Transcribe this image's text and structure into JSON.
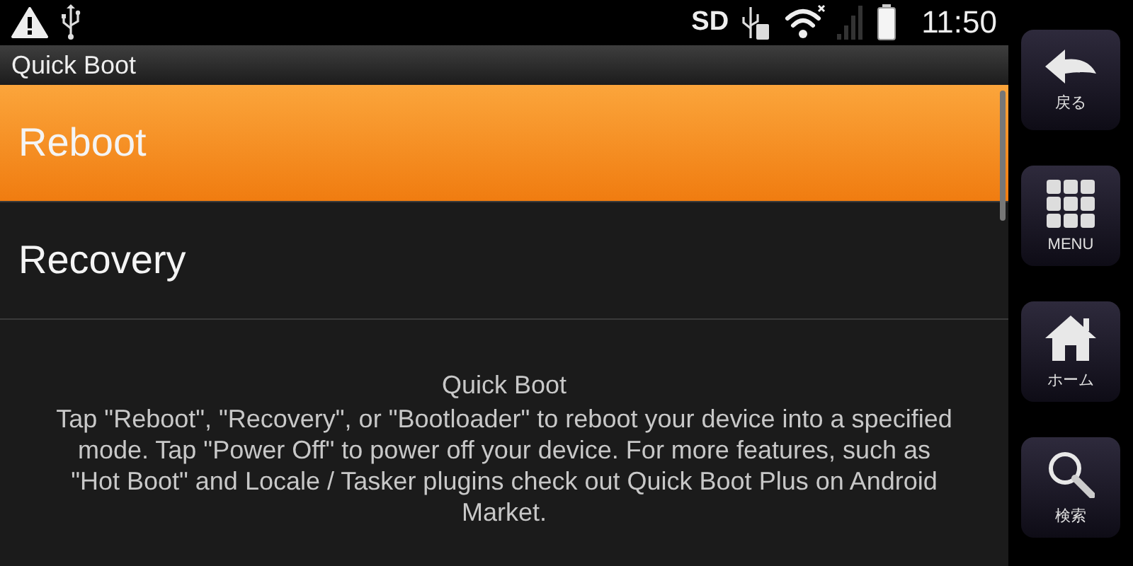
{
  "status_bar": {
    "sd_label": "SD",
    "time": "11:50"
  },
  "window": {
    "title": "Quick Boot"
  },
  "items": [
    {
      "label": "Reboot",
      "selected": true
    },
    {
      "label": "Recovery",
      "selected": false
    }
  ],
  "description": {
    "title": "Quick Boot",
    "text": "Tap \"Reboot\", \"Recovery\", or \"Bootloader\" to reboot your device into a specified mode. Tap \"Power Off\" to power off your device. For more features, such as \"Hot Boot\" and Locale / Tasker plugins check out Quick Boot Plus on Android Market."
  },
  "nav_buttons": [
    {
      "kind": "back",
      "label": "戻る"
    },
    {
      "kind": "menu",
      "label": "MENU"
    },
    {
      "kind": "home",
      "label": "ホーム"
    },
    {
      "kind": "search",
      "label": "検索"
    }
  ]
}
